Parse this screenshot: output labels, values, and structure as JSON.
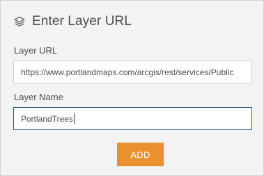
{
  "dialog": {
    "title": "Enter Layer URL",
    "icon": "layers-icon"
  },
  "layer_url": {
    "label": "Layer URL",
    "value": "https://www.portlandmaps.com/arcgis/rest/services/Public"
  },
  "layer_name": {
    "label": "Layer Name",
    "value": "PortlandTrees"
  },
  "actions": {
    "add_label": "ADD"
  },
  "colors": {
    "panel_background": "#f3f3f3",
    "accent_button": "#e8912e",
    "focused_border": "#2a5a8a",
    "text": "#4c4c4c"
  }
}
